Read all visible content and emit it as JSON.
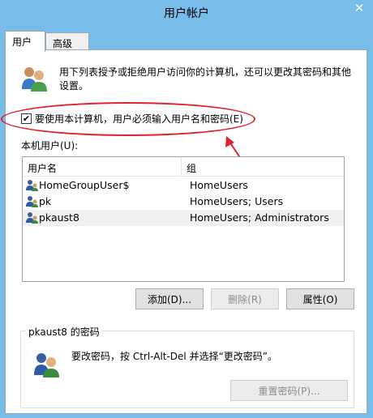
{
  "window": {
    "title": "用户帐户",
    "close_glyph": "✕"
  },
  "tabs": [
    {
      "label": "用户",
      "active": true
    },
    {
      "label": "高级",
      "active": false
    }
  ],
  "intro": {
    "text": "用下列表授予或拒绝用户访问你的计算机，还可以更改其密码和其他设置。",
    "icon": "users-icon"
  },
  "require_password": {
    "checked": true,
    "mark": "✔",
    "label": "要使用本计算机，用户必须输入用户名和密码(E)"
  },
  "annotation": {
    "color": "#e0222b"
  },
  "users_list": {
    "label": "本机用户(U):",
    "columns": [
      "用户名",
      "组"
    ],
    "rows": [
      {
        "name": "HomeGroupUser$",
        "group": "HomeUsers",
        "selected": false
      },
      {
        "name": "pk",
        "group": "HomeUsers; Users",
        "selected": false
      },
      {
        "name": "pkaust8",
        "group": "HomeUsers; Administrators",
        "selected": true
      }
    ]
  },
  "buttons": {
    "add": "添加(D)...",
    "delete": "删除(R)",
    "properties": "属性(O)"
  },
  "password_group": {
    "title": "pkaust8 的密码",
    "text": "要改密码，按 Ctrl-Alt-Del 并选择“更改密码”。",
    "reset_button": "重置密码(P)..."
  },
  "colors": {
    "titlebar": "#78bce9",
    "panel": "#ffffff"
  }
}
